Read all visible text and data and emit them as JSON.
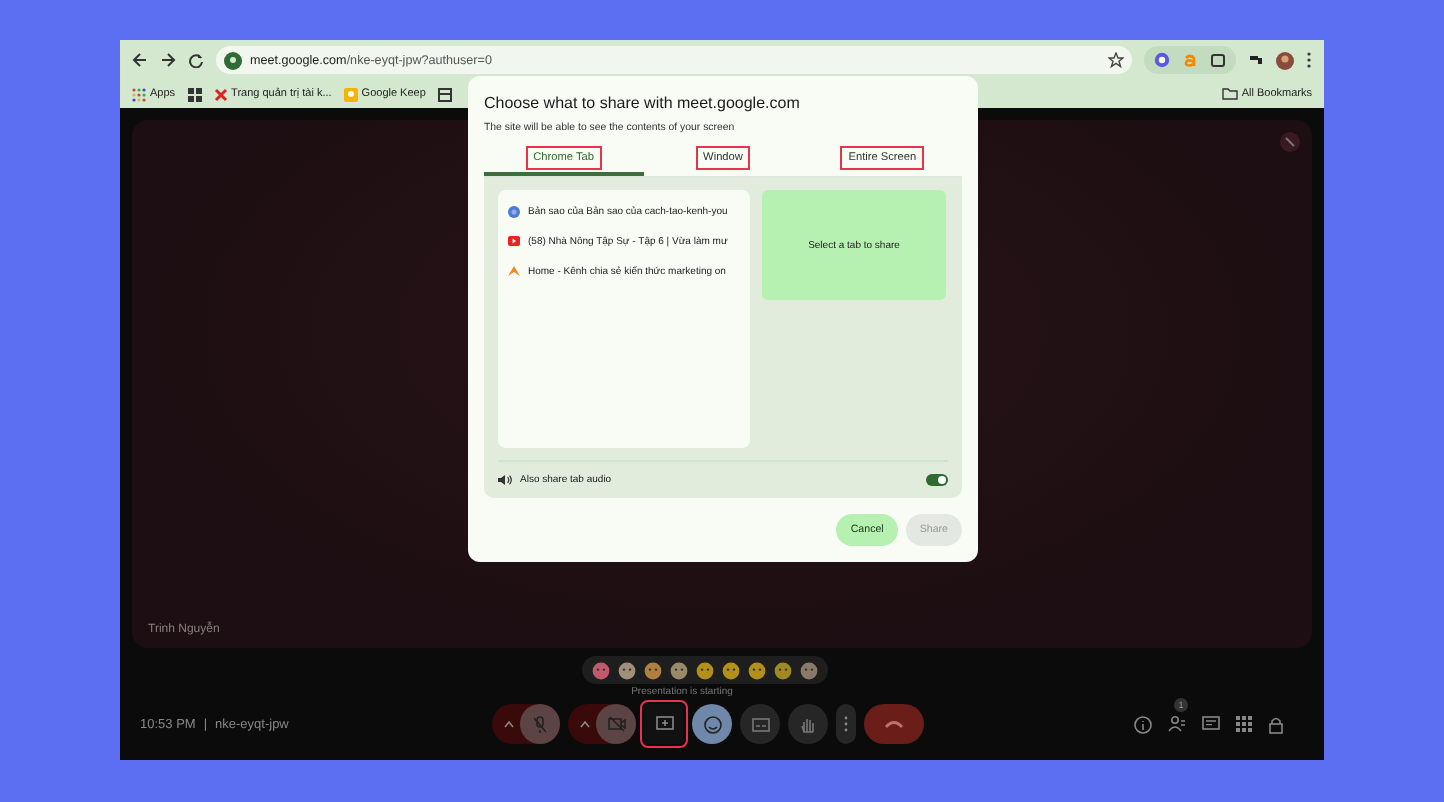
{
  "browser": {
    "url_host": "meet.google.com",
    "url_path": "/nke-eyqt-jpw?authuser=0",
    "bookmarks": [
      {
        "kind": "apps",
        "label": "Apps"
      },
      {
        "kind": "grid"
      },
      {
        "kind": "x-site",
        "label": "Trang quản trị tài k..."
      },
      {
        "kind": "keep-site",
        "label": "Google Keep"
      },
      {
        "kind": "box-site"
      }
    ],
    "all_bookmarks": "All Bookmarks"
  },
  "meet": {
    "participant": "Trinh Nguyễn",
    "tooltip": "Presentation is starting",
    "time": "10:53 PM",
    "separator": "|",
    "meeting_code": "nke-eyqt-jpw",
    "people_count": "1",
    "controls": [
      {
        "kind": "mic",
        "on": false,
        "highlighted": false
      },
      {
        "kind": "camera",
        "on": false,
        "highlighted": false
      },
      {
        "kind": "present",
        "on": false,
        "highlighted": true
      },
      {
        "kind": "emoji",
        "on": true,
        "highlighted": false
      },
      {
        "kind": "captions",
        "on": false,
        "highlighted": false
      },
      {
        "kind": "hand",
        "on": false,
        "highlighted": false
      },
      {
        "kind": "more",
        "on": false,
        "highlighted": false
      },
      {
        "kind": "end",
        "on": false,
        "highlighted": false
      }
    ]
  },
  "dialog": {
    "title": "Choose what to share with meet.google.com",
    "subtitle": "The site will be able to see the contents of your screen",
    "tabs": [
      {
        "label": "Chrome Tab",
        "selected": true,
        "highlighted": true
      },
      {
        "label": "Window",
        "selected": false,
        "highlighted": true
      },
      {
        "label": "Entire Screen",
        "selected": false,
        "highlighted": true
      }
    ],
    "tab_list": [
      {
        "kind": "web",
        "title": "Bản sao của Bản sao của cach-tao-kenh-you"
      },
      {
        "kind": "video",
        "title": "(58) Nhà Nông Tập Sự - Tập 6 | Vừa làm mư"
      },
      {
        "kind": "home",
        "title": "Home - Kênh chia sẻ kiến thức marketing on"
      }
    ],
    "preview": "Select a tab to share",
    "audio": {
      "label": "Also share tab audio",
      "on": true
    },
    "buttons": [
      {
        "label": "Cancel",
        "disabled": false
      },
      {
        "label": "Share",
        "disabled": true
      }
    ]
  }
}
